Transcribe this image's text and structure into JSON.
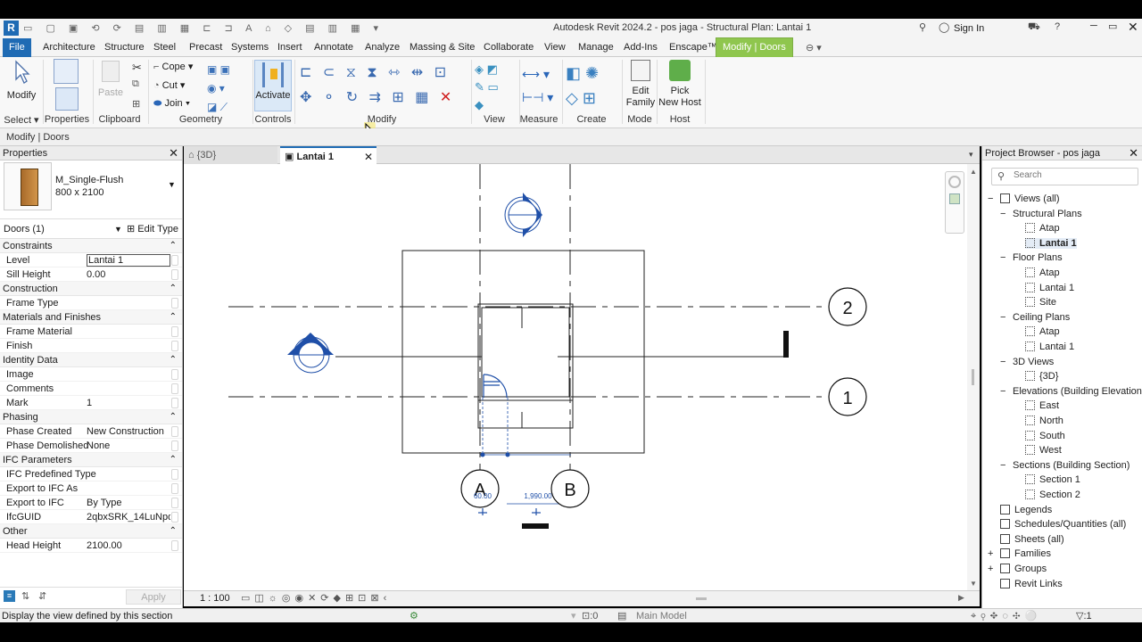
{
  "window": {
    "title": "Autodesk Revit 2024.2 - pos jaga - Structural Plan: Lantai 1",
    "sign_in": "Sign In"
  },
  "ribbon_tabs": [
    "File",
    "Architecture",
    "Structure",
    "Steel",
    "Precast",
    "Systems",
    "Insert",
    "Annotate",
    "Analyze",
    "Massing & Site",
    "Collaborate",
    "View",
    "Manage",
    "Add-Ins",
    "Enscape™",
    "Modify | Doors"
  ],
  "ribbon": {
    "modify": "Modify",
    "paste": "Paste",
    "cope": "Cope",
    "cut": "Cut",
    "join": "Join",
    "activate": "Activate",
    "edit_family": [
      "Edit",
      "Family"
    ],
    "pick_host": [
      "Pick",
      "New Host"
    ],
    "panels": [
      "Select",
      "Properties",
      "Clipboard",
      "Geometry",
      "Controls",
      "Modify",
      "View",
      "Measure",
      "Create",
      "Mode",
      "Host"
    ]
  },
  "context_bar": "Modify | Doors",
  "properties": {
    "title": "Properties",
    "family": "M_Single-Flush",
    "type": "800 x 2100",
    "selector": "Doors (1)",
    "edit_type": "Edit Type",
    "groups": [
      {
        "name": "Constraints",
        "rows": [
          [
            "Level",
            "Lantai 1"
          ],
          [
            "Sill Height",
            "0.00"
          ]
        ]
      },
      {
        "name": "Construction",
        "rows": [
          [
            "Frame Type",
            ""
          ]
        ]
      },
      {
        "name": "Materials and Finishes",
        "rows": [
          [
            "Frame Material",
            ""
          ],
          [
            "Finish",
            ""
          ]
        ]
      },
      {
        "name": "Identity Data",
        "rows": [
          [
            "Image",
            ""
          ],
          [
            "Comments",
            ""
          ],
          [
            "Mark",
            "1"
          ]
        ]
      },
      {
        "name": "Phasing",
        "rows": [
          [
            "Phase Created",
            "New Construction"
          ],
          [
            "Phase Demolished",
            "None"
          ]
        ]
      },
      {
        "name": "IFC Parameters",
        "rows": [
          [
            "IFC Predefined Type",
            ""
          ],
          [
            "Export to IFC As",
            ""
          ],
          [
            "Export to IFC",
            "By Type"
          ],
          [
            "IfcGUID",
            "2qbxSRK_14LuNpd..."
          ]
        ]
      },
      {
        "name": "Other",
        "rows": [
          [
            "Head Height",
            "2100.00"
          ]
        ]
      }
    ],
    "apply": "Apply"
  },
  "view_tabs": [
    "{3D}",
    "Lantai 1"
  ],
  "drawing": {
    "grid_labels": [
      "2",
      "1",
      "A",
      "B"
    ],
    "dims": [
      "60.00",
      "1,990.00"
    ],
    "scale": "1 : 100"
  },
  "browser": {
    "title": "Project Browser - pos jaga",
    "search_placeholder": "Search",
    "nodes": [
      "Views (all)",
      "Structural Plans",
      "Atap",
      "Lantai 1",
      "Floor Plans",
      "Atap",
      "Lantai 1",
      "Site",
      "Ceiling Plans",
      "Atap",
      "Lantai 1",
      "3D Views",
      "{3D}",
      "Elevations (Building Elevation)",
      "East",
      "North",
      "South",
      "West",
      "Sections (Building Section)",
      "Section 1",
      "Section 2",
      "Legends",
      "Schedules/Quantities (all)",
      "Sheets (all)",
      "Families",
      "Groups",
      "Revit Links"
    ]
  },
  "status": {
    "hint": "Display the view defined by this section",
    "model": "Main Model",
    "sel_count": ":0",
    "filter_count": ":1"
  },
  "colors": {
    "file_tab": "#1f6bb4",
    "context_tab": "#8fc64e",
    "selection_blue": "#1f4fa8"
  }
}
